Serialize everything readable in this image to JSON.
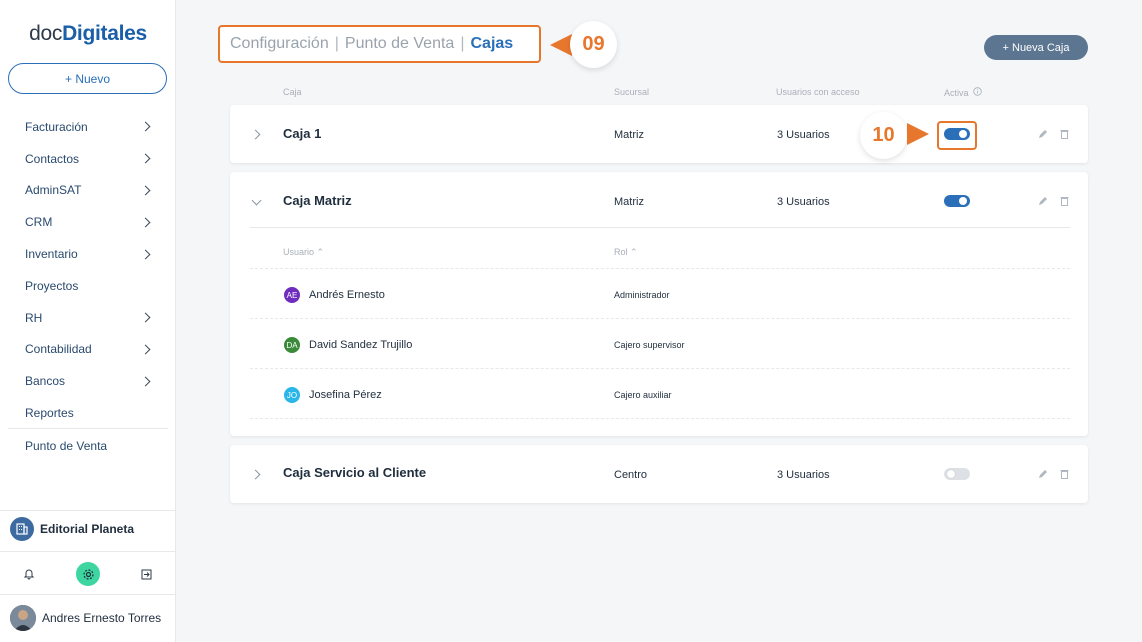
{
  "sidebar": {
    "logo": {
      "part1": "doc",
      "part2": "Digitales"
    },
    "new_button": "+ Nuevo",
    "items": [
      {
        "label": "Facturación"
      },
      {
        "label": "Contactos"
      },
      {
        "label": "AdminSAT"
      },
      {
        "label": "CRM"
      },
      {
        "label": "Inventario"
      },
      {
        "label": "Proyectos"
      },
      {
        "label": "RH"
      },
      {
        "label": "Contabilidad"
      },
      {
        "label": "Bancos"
      },
      {
        "label": "Reportes"
      }
    ],
    "punto_venta": "Punto de Venta",
    "company": "Editorial Planeta",
    "user": "Andres Ernesto Torres"
  },
  "header": {
    "breadcrumb": [
      "Configuración",
      "Punto de Venta",
      "Cajas"
    ],
    "breadcrumb_sep": "|",
    "badge_step": "09",
    "new_caja_label": "+ Nueva Caja"
  },
  "table": {
    "columns": [
      "Caja",
      "Sucursal",
      "Usuarios con acceso",
      "Activa"
    ],
    "rows": [
      {
        "name": "Caja 1",
        "sucursal": "Matriz",
        "usuarios": "3 Usuarios",
        "active": true
      },
      {
        "name": "Caja Matriz",
        "sucursal": "Matriz",
        "usuarios": "3 Usuarios",
        "active": true
      },
      {
        "name": "Caja Servicio al Cliente",
        "sucursal": "Centro",
        "usuarios": "3 Usuarios",
        "active": false
      }
    ],
    "badge_step": "10",
    "expanded": {
      "columns": [
        "Usuario",
        "Rol"
      ],
      "users": [
        {
          "initials": "AE",
          "name": "Andrés Ernesto",
          "role": "Administrador",
          "color": "#6f2dbd"
        },
        {
          "initials": "DA",
          "name": "David Sandez Trujillo",
          "role": "Cajero supervisor",
          "color": "#3a8a3a"
        },
        {
          "initials": "JO",
          "name": "Josefina Pérez",
          "role": "Cajero auxiliar",
          "color": "#2ab6e8"
        }
      ]
    }
  },
  "colors": {
    "accent": "#2a6fb8",
    "highlight": "#e8772e"
  }
}
